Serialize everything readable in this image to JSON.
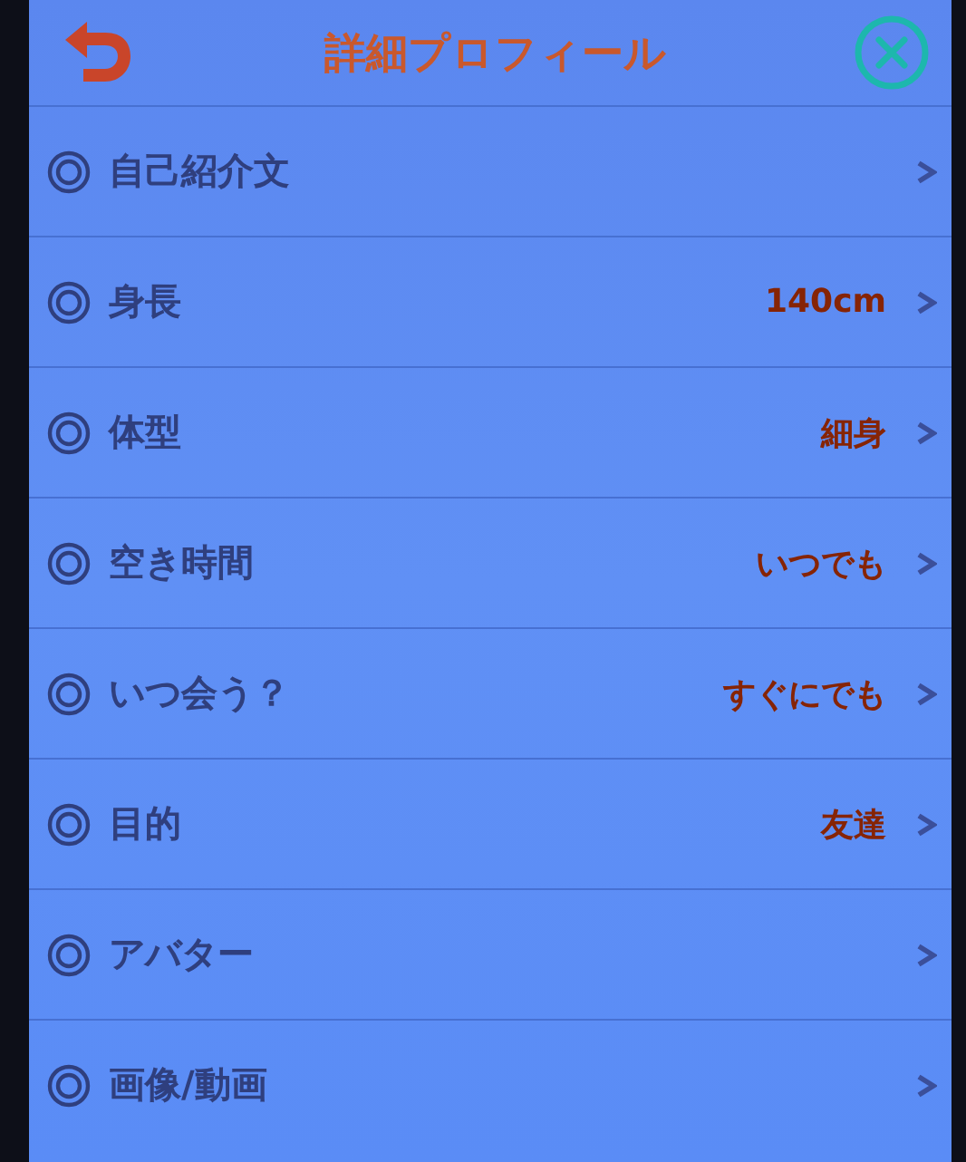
{
  "header": {
    "title": "詳細プロフィール"
  },
  "rows": [
    {
      "label": "自己紹介文"
    },
    {
      "label": "身長",
      "value": "140cm"
    },
    {
      "label": "体型",
      "value": "細身"
    },
    {
      "label": "空き時間",
      "value": "いつでも"
    },
    {
      "label": "いつ会う？",
      "value": "すぐにでも"
    },
    {
      "label": "目的",
      "value": "友達"
    },
    {
      "label": "アバター"
    },
    {
      "label": "画像/動画"
    }
  ]
}
